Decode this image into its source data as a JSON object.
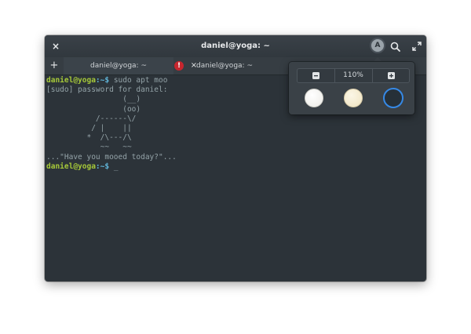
{
  "window": {
    "title": "daniel@yoga: ~",
    "close_label": "×"
  },
  "icons": {
    "font": "A",
    "search": "search-icon",
    "fullscreen": "fullscreen-icon"
  },
  "tabs": [
    {
      "label": "daniel@yoga: ~",
      "has_alert": true,
      "alert_label": "!",
      "close_label": "×"
    },
    {
      "label": "daniel@yoga: ~"
    }
  ],
  "new_tab_label": "+",
  "terminal": {
    "prompt_user": "daniel@yoga",
    "prompt_path": ":~$",
    "command": " sudo apt moo",
    "lines": [
      "[sudo] password for daniel:",
      "                 (__)",
      "                 (oo)",
      "           /------\\/",
      "          / |    ||",
      "         *  /\\---/\\",
      "            ~~   ~~",
      "...\"Have you mooed today?\"..."
    ],
    "final_prompt_user": "daniel@yoga",
    "final_prompt_path": ":~$",
    "cursor": " _"
  },
  "popover": {
    "zoom_out_label": "−",
    "zoom_value": "110%",
    "zoom_in_label": "+",
    "themes": [
      "light",
      "solarized-light",
      "dark"
    ]
  },
  "colors": {
    "background": "#2c3339",
    "prompt_user": "#a6c939",
    "prompt_path": "#60b4d8",
    "selected_theme_ring": "#3689e6",
    "alert": "#c6262e"
  }
}
